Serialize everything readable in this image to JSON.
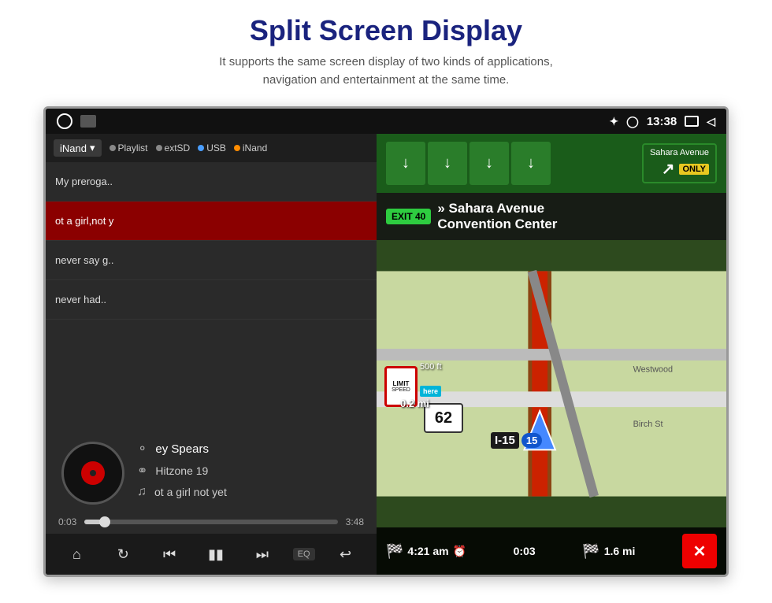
{
  "header": {
    "title": "Split Screen Display",
    "subtitle": "It supports the same screen display of two kinds of applications,\nnavigation and entertainment at the same time."
  },
  "status_bar": {
    "time": "13:38",
    "bluetooth_icon": "bluetooth",
    "location_icon": "location-pin",
    "window_icon": "window",
    "back_icon": "back-triangle"
  },
  "music_panel": {
    "source_dropdown": "iNand",
    "source_tabs": [
      {
        "label": "Playlist",
        "dot_color": "gray"
      },
      {
        "label": "extSD",
        "dot_color": "gray"
      },
      {
        "label": "USB",
        "dot_color": "blue"
      },
      {
        "label": "iNand",
        "dot_color": "orange"
      }
    ],
    "playlist": [
      {
        "label": "My preroga..",
        "active": false
      },
      {
        "label": "ot a girl,not y",
        "active": true
      },
      {
        "label": "never say g..",
        "active": false
      },
      {
        "label": "never had..",
        "active": false
      }
    ],
    "track_artist": "ey Spears",
    "track_album": "Hitzone 19",
    "track_title": "ot a girl not yet",
    "progress_current": "0:03",
    "progress_total": "3:48",
    "controls": {
      "home": "⌂",
      "repeat": "↻",
      "prev": "⏮",
      "play_pause": "⏸",
      "next": "⏭",
      "eq": "EQ",
      "back": "↩"
    }
  },
  "nav_panel": {
    "highway": "I-15",
    "exit_number": "EXIT 40",
    "destination_line1": "» Sahara Avenue",
    "destination_line2": "Convention Center",
    "only_label": "ONLY",
    "distance_to_turn": "0.2 mi",
    "current_speed": "62",
    "road_label": "I-15",
    "shield_number": "15",
    "speed_limit_label": "LIMIT",
    "speed_limit_value": "500 ft",
    "here_logo": "here",
    "bottom_stats": {
      "eta": "4:21 am",
      "elapsed": "0:03",
      "remaining": "1.6 mi"
    },
    "close_label": "✕"
  }
}
